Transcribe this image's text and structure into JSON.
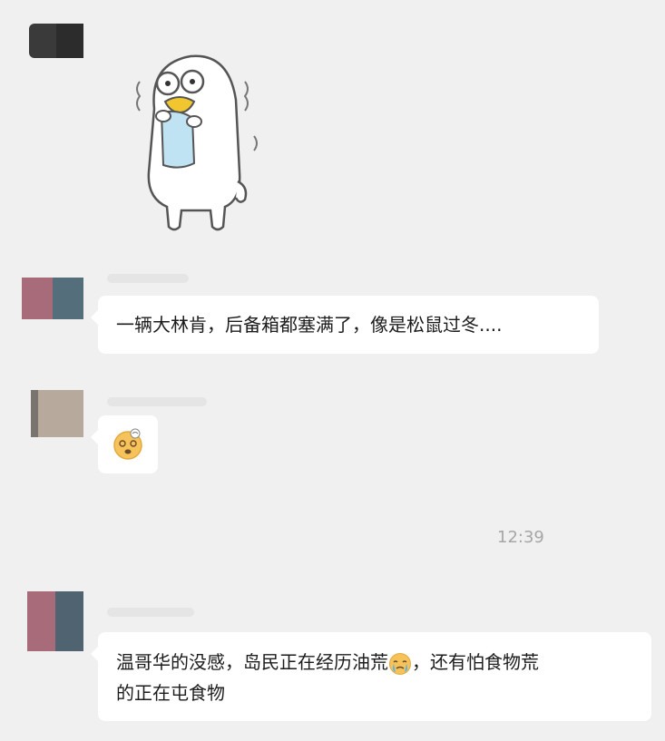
{
  "colors": {
    "background": "#f0f0f0",
    "bubble": "#ffffff",
    "text": "#1c1c1c",
    "timestamp": "#a6a6a6"
  },
  "messages": [
    {
      "type": "sticker",
      "content": "duck-sticker"
    },
    {
      "type": "text",
      "text": "一辆大林肯，后备箱都塞满了，像是松鼠过冬...."
    },
    {
      "type": "emoji",
      "content": "dizzy-face-emoji"
    },
    {
      "type": "text",
      "line1": "温哥华的没感，岛民正在经历油荒",
      "line1_end": "，还有怕食物荒",
      "line2": "的正在屯食物",
      "inline_emoji": "crying-emoji"
    }
  ],
  "timestamp": "12:39"
}
